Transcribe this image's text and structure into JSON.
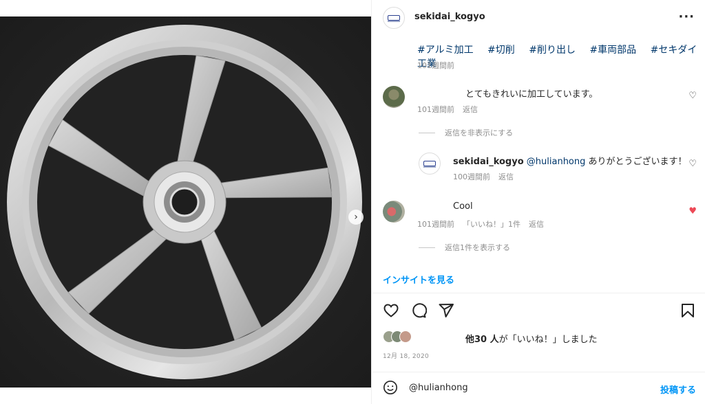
{
  "post": {
    "username": "sekidai_kogyo",
    "more_icon": "more-horizontal-icon",
    "hashtags": [
      "#アルミ加工",
      "#切削",
      "#削り出し",
      "#車両部品",
      "#セキダイ工業"
    ],
    "caption_time": "101週間前"
  },
  "comments": [
    {
      "text": "とてもきれいに加工しています。",
      "time": "101週間前",
      "reply_label": "返信",
      "toggle_label": "返信を非表示にする",
      "liked": false
    },
    {
      "username": "sekidai_kogyo",
      "mention": "@hulianhong",
      "text": "ありがとうございます！",
      "time": "100週間前",
      "reply_label": "返信",
      "liked": false
    },
    {
      "text": "Cool",
      "time": "101週間前",
      "likes_label": "「いいね！」1件",
      "reply_label": "返信",
      "toggle_label": "返信1件を表示する",
      "liked": true
    }
  ],
  "insights_label": "インサイトを見る",
  "likes": {
    "count_text": "他30 人",
    "suffix": "が「いいね！」しました"
  },
  "date": "12月 18, 2020",
  "comment_input": {
    "value": "@hulianhong",
    "post_label": "投稿する"
  },
  "colors": {
    "link": "#00376b",
    "accent": "#0095f6",
    "like_red": "#ed4956",
    "muted": "#8e8e8e"
  },
  "carousel": {
    "current": 1,
    "total": 3
  }
}
